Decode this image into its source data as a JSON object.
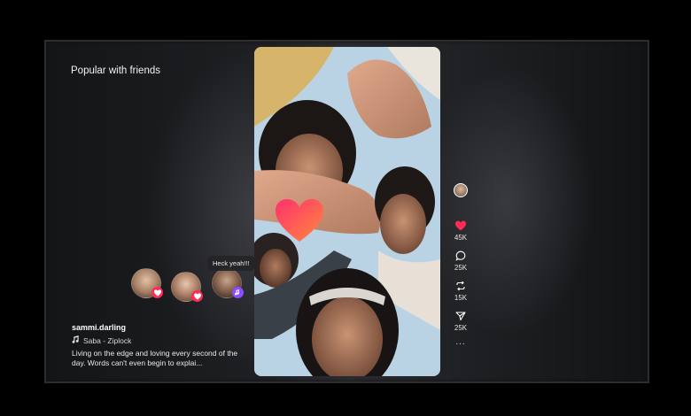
{
  "section": {
    "title": "Popular with friends"
  },
  "friends": {
    "reaction_bubble": "Heck yeah!!!",
    "avatars": [
      {
        "badge_icon": "heart-icon"
      },
      {
        "badge_icon": "heart-icon"
      },
      {
        "badge_icon": "music-icon"
      }
    ]
  },
  "post": {
    "username": "sammi.darling",
    "sound": "Saba - Ziplock",
    "description": "Living on the edge and loving every second of the day. Words can't even begin to explai..."
  },
  "actions": {
    "likes": "45K",
    "comments": "25K",
    "reposts": "15K",
    "shares": "25K",
    "more": "..."
  },
  "colors": {
    "like": "#fe2c55",
    "badge_music": "#8a4dff"
  }
}
